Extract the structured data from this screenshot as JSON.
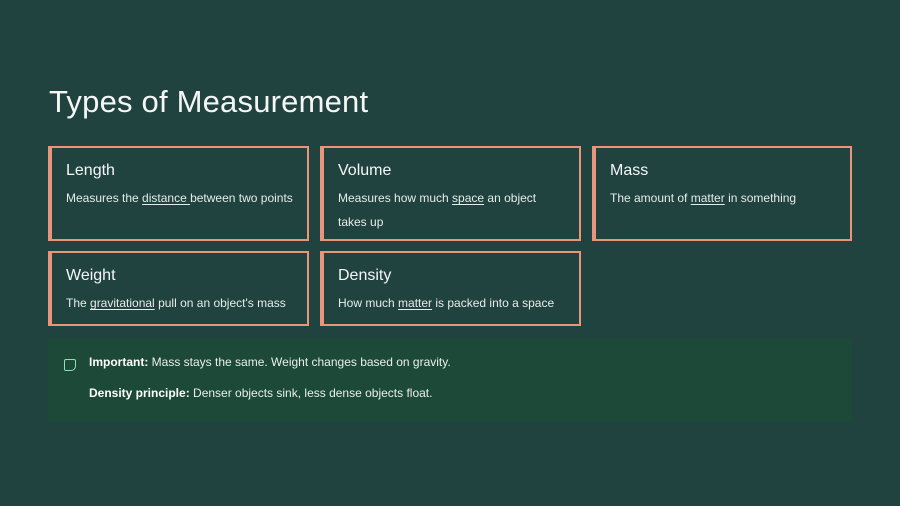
{
  "page": {
    "title": "Types of Measurement"
  },
  "cards": [
    {
      "title": "Length",
      "desc_before": "Measures the ",
      "desc_link": "distance ",
      "desc_after": "between two points"
    },
    {
      "title": "Volume",
      "desc_before": "Measures how much ",
      "desc_link": "space",
      "desc_after": " an object takes up"
    },
    {
      "title": "Mass",
      "desc_before": "The amount of ",
      "desc_link": "matter",
      "desc_after": " in something"
    },
    {
      "title": "Weight",
      "desc_before": "The ",
      "desc_link": "gravitational",
      "desc_after": " pull on an object's mass"
    },
    {
      "title": "Density",
      "desc_before": "How much ",
      "desc_link": "matter",
      "desc_after": " is packed into a space"
    }
  ],
  "note": {
    "icon": "note-icon",
    "lines": [
      {
        "label": "Important:",
        "text": " Mass stays the same. Weight changes based on gravity."
      },
      {
        "label": "Density principle:",
        "text": " Denser objects sink, less dense objects float."
      }
    ]
  },
  "colors": {
    "background": "#21433f",
    "card_border": "#e9957a",
    "note_background": "#1d4939",
    "note_icon": "#8fe0b8"
  }
}
